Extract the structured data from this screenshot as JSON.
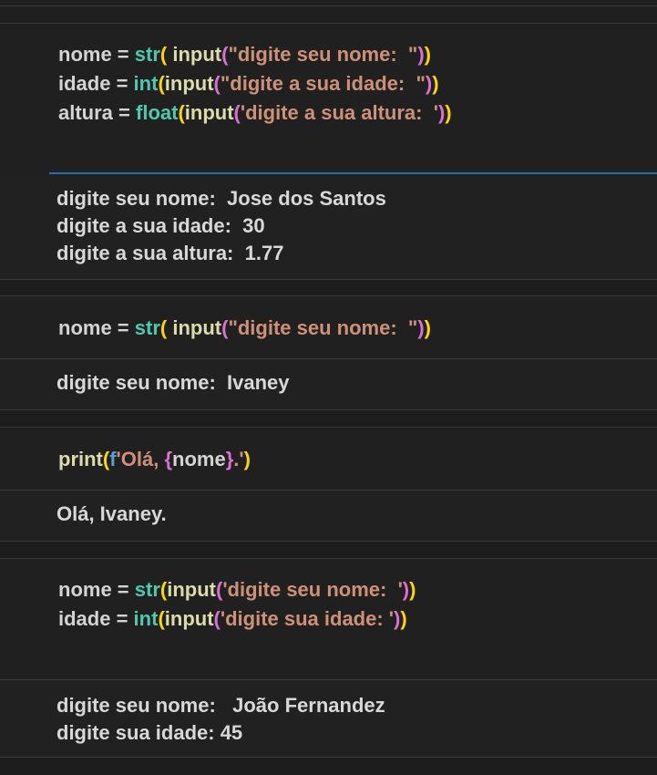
{
  "colors": {
    "background": "#1f1f1f",
    "variable": "#d4d4d4",
    "builtin_type": "#4ec9b0",
    "function": "#dcdcaa",
    "string": "#ce9178",
    "bracket_level1": "#ffd700",
    "bracket_level2": "#da70d6",
    "fstring_prefix": "#569cd6",
    "focus_border": "#1f6fb2",
    "separator": "#3a3a3a"
  },
  "cells": [
    {
      "code": [
        [
          {
            "t": "nome",
            "k": "var"
          },
          {
            "t": " = ",
            "k": "op"
          },
          {
            "t": "str",
            "k": "type"
          },
          {
            "t": "(",
            "k": "b1"
          },
          {
            "t": " ",
            "k": "pun"
          },
          {
            "t": "input",
            "k": "fn"
          },
          {
            "t": "(",
            "k": "b2"
          },
          {
            "t": "\"digite seu nome:  \"",
            "k": "str"
          },
          {
            "t": ")",
            "k": "b2"
          },
          {
            "t": ")",
            "k": "b1"
          }
        ],
        [
          {
            "t": "idade",
            "k": "var"
          },
          {
            "t": " = ",
            "k": "op"
          },
          {
            "t": "int",
            "k": "type"
          },
          {
            "t": "(",
            "k": "b1"
          },
          {
            "t": "input",
            "k": "fn"
          },
          {
            "t": "(",
            "k": "b2"
          },
          {
            "t": "\"digite a sua idade:  \"",
            "k": "str"
          },
          {
            "t": ")",
            "k": "b2"
          },
          {
            "t": ")",
            "k": "b1"
          }
        ],
        [
          {
            "t": "altura",
            "k": "var"
          },
          {
            "t": " = ",
            "k": "op"
          },
          {
            "t": "float",
            "k": "type"
          },
          {
            "t": "(",
            "k": "b1"
          },
          {
            "t": "input",
            "k": "fn"
          },
          {
            "t": "(",
            "k": "b2"
          },
          {
            "t": "'digite a sua altura:  '",
            "k": "str"
          },
          {
            "t": ")",
            "k": "b2"
          },
          {
            "t": ")",
            "k": "b1"
          }
        ]
      ],
      "output": [
        "digite seu nome:  Jose dos Santos",
        "digite a sua idade:  30",
        "digite a sua altura:  1.77"
      ]
    },
    {
      "code": [
        [
          {
            "t": "nome",
            "k": "var"
          },
          {
            "t": " = ",
            "k": "op"
          },
          {
            "t": "str",
            "k": "type"
          },
          {
            "t": "(",
            "k": "b1"
          },
          {
            "t": " ",
            "k": "pun"
          },
          {
            "t": "input",
            "k": "fn"
          },
          {
            "t": "(",
            "k": "b2"
          },
          {
            "t": "\"digite seu nome:  \"",
            "k": "str"
          },
          {
            "t": ")",
            "k": "b2"
          },
          {
            "t": ")",
            "k": "b1"
          }
        ]
      ],
      "output": [
        "digite seu nome:  Ivaney"
      ]
    },
    {
      "code": [
        [
          {
            "t": "print",
            "k": "fn"
          },
          {
            "t": "(",
            "k": "b1"
          },
          {
            "t": "f",
            "k": "fpre"
          },
          {
            "t": "'Olá, ",
            "k": "str"
          },
          {
            "t": "{",
            "k": "b2"
          },
          {
            "t": "nome",
            "k": "var"
          },
          {
            "t": "}",
            "k": "b2"
          },
          {
            "t": ".'",
            "k": "str"
          },
          {
            "t": ")",
            "k": "b1"
          }
        ]
      ],
      "output": [
        "Olá, Ivaney."
      ]
    },
    {
      "code": [
        [
          {
            "t": "nome",
            "k": "var"
          },
          {
            "t": " = ",
            "k": "op"
          },
          {
            "t": "str",
            "k": "type"
          },
          {
            "t": "(",
            "k": "b1"
          },
          {
            "t": "input",
            "k": "fn"
          },
          {
            "t": "(",
            "k": "b2"
          },
          {
            "t": "'digite seu nome:  '",
            "k": "str"
          },
          {
            "t": ")",
            "k": "b2"
          },
          {
            "t": ")",
            "k": "b1"
          }
        ],
        [
          {
            "t": "idade",
            "k": "var"
          },
          {
            "t": " = ",
            "k": "op"
          },
          {
            "t": "int",
            "k": "type"
          },
          {
            "t": "(",
            "k": "b1"
          },
          {
            "t": "input",
            "k": "fn"
          },
          {
            "t": "(",
            "k": "b2"
          },
          {
            "t": "'digite sua idade: '",
            "k": "str"
          },
          {
            "t": ")",
            "k": "b2"
          },
          {
            "t": ")",
            "k": "b1"
          }
        ]
      ],
      "output": [
        "digite seu nome:   João Fernandez",
        "digite sua idade: 45"
      ]
    }
  ]
}
